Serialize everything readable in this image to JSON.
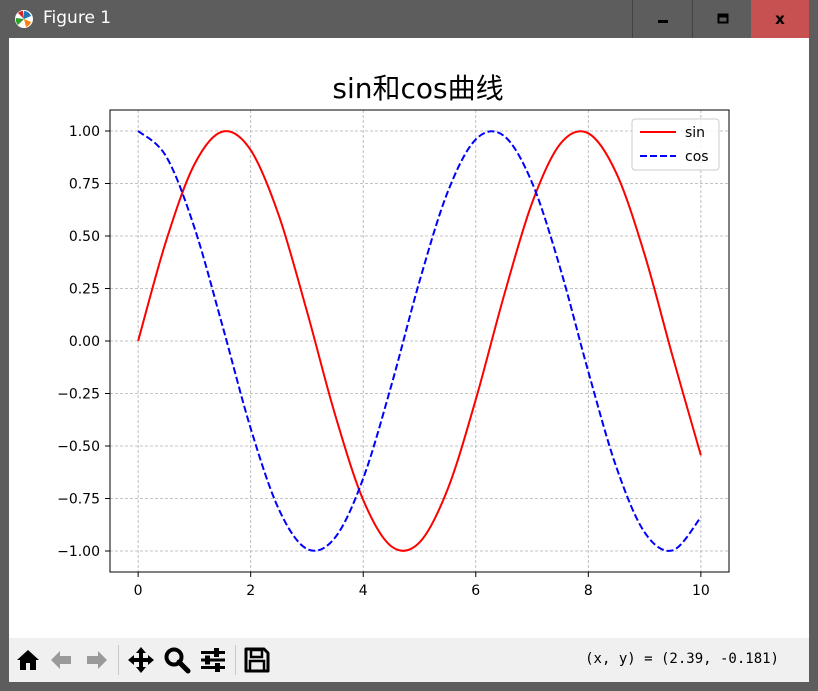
{
  "window": {
    "title": "Figure 1",
    "controls": {
      "minimize": "minimize",
      "maximize": "maximize",
      "close": "x"
    }
  },
  "toolbar": {
    "icons": [
      "home-icon",
      "back-icon",
      "forward-icon",
      "pan-icon",
      "zoom-icon",
      "configure-subplots-icon",
      "save-icon"
    ],
    "coords_text": "(x, y) = (2.39, -0.181)"
  },
  "chart_data": {
    "type": "line",
    "title": "sin和cos曲线",
    "xlabel": "",
    "ylabel": "",
    "xlim": [
      -0.5,
      10.5
    ],
    "ylim": [
      -1.1,
      1.1
    ],
    "x_ticks": [
      "0",
      "2",
      "4",
      "6",
      "8",
      "10"
    ],
    "y_ticks": [
      "1.00",
      "0.75",
      "0.50",
      "0.25",
      "0.00",
      "−0.25",
      "−0.50",
      "−0.75",
      "−1.00"
    ],
    "grid": true,
    "legend": "top-right",
    "series": [
      {
        "name": "sin",
        "color": "#ff0000",
        "style": "solid",
        "x": [
          0,
          0.5,
          1,
          1.5,
          2,
          2.5,
          3,
          3.5,
          4,
          4.5,
          5,
          5.5,
          6,
          6.5,
          7,
          7.5,
          8,
          8.5,
          9,
          9.5,
          10
        ],
        "values": [
          0.0,
          0.479,
          0.841,
          0.997,
          0.909,
          0.598,
          0.141,
          -0.351,
          -0.757,
          -0.978,
          -0.959,
          -0.706,
          -0.279,
          0.215,
          0.657,
          0.938,
          0.989,
          0.798,
          0.412,
          -0.075,
          -0.544
        ]
      },
      {
        "name": "cos",
        "color": "#0000ff",
        "style": "dashed",
        "x": [
          0,
          0.5,
          1,
          1.5,
          2,
          2.5,
          3,
          3.5,
          4,
          4.5,
          5,
          5.5,
          6,
          6.5,
          7,
          7.5,
          8,
          8.5,
          9,
          9.5,
          10
        ],
        "values": [
          1.0,
          0.878,
          0.54,
          0.071,
          -0.416,
          -0.801,
          -0.99,
          -0.936,
          -0.654,
          -0.211,
          0.284,
          0.709,
          0.96,
          0.977,
          0.754,
          0.347,
          -0.146,
          -0.602,
          -0.911,
          -0.997,
          -0.839
        ]
      }
    ]
  }
}
